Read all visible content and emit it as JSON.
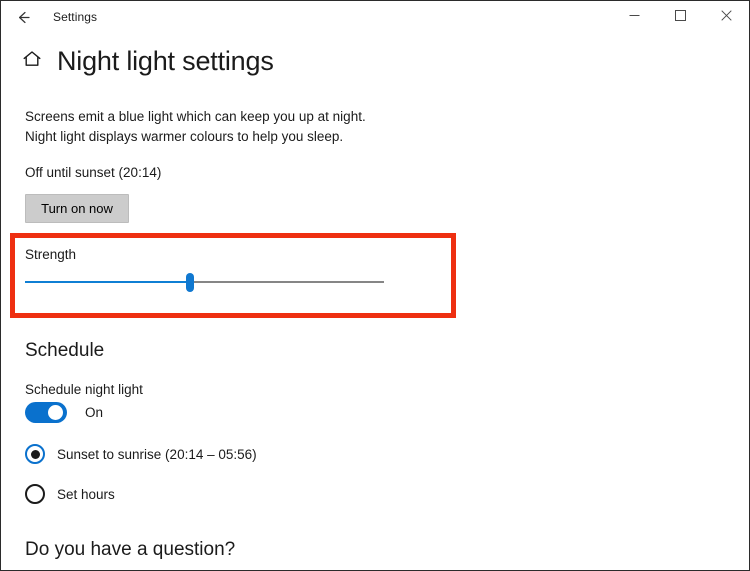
{
  "window": {
    "title": "Settings",
    "back_icon": "back-arrow-icon",
    "controls": {
      "minimize": "minimize-icon",
      "maximize": "maximize-icon",
      "close": "close-icon"
    }
  },
  "header": {
    "home_icon": "home-icon",
    "title": "Night light settings"
  },
  "main": {
    "description": "Screens emit a blue light which can keep you up at night. Night light displays warmer colours to help you sleep.",
    "status": "Off until sunset (20:14)",
    "turn_on_label": "Turn on now",
    "strength": {
      "label": "Strength",
      "value_percent": 46,
      "highlight_color": "#ee2f11",
      "fill_color": "#0f7fd4",
      "track_color": "#868686"
    },
    "schedule": {
      "heading": "Schedule",
      "toggle_label": "Schedule night light",
      "toggle_state": "On",
      "toggle_on": true,
      "accent_color": "#0a71cd",
      "options": [
        {
          "label": "Sunset to sunrise (20:14 – 05:56)",
          "selected": true
        },
        {
          "label": "Set hours",
          "selected": false
        }
      ]
    },
    "question_heading": "Do you have a question?"
  }
}
